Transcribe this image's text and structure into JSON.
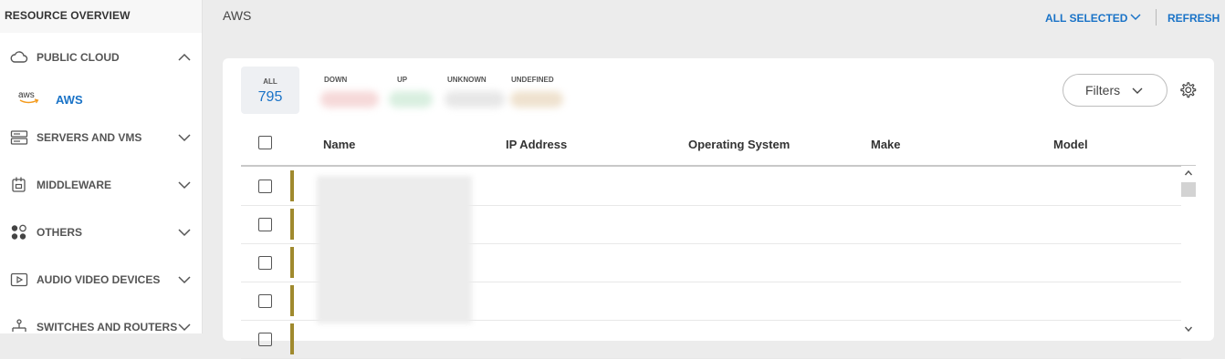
{
  "sidebar": {
    "title": "RESOURCE OVERVIEW",
    "items": [
      {
        "label": "PUBLIC CLOUD",
        "icon": "cloud-icon",
        "chevron": "chevron-up-icon"
      },
      {
        "label": "SERVERS AND VMS",
        "icon": "server-icon",
        "chevron": "chevron-down-icon"
      },
      {
        "label": "MIDDLEWARE",
        "icon": "middleware-icon",
        "chevron": "chevron-down-icon"
      },
      {
        "label": "OTHERS",
        "icon": "others-dots-icon",
        "chevron": "chevron-down-icon"
      },
      {
        "label": "AUDIO VIDEO DEVICES",
        "icon": "video-play-icon",
        "chevron": "chevron-down-icon"
      },
      {
        "label": "SWITCHES AND ROUTERS",
        "icon": "network-icon",
        "chevron": "chevron-down-icon"
      }
    ],
    "sub_item": {
      "label": "AWS",
      "icon": "aws-logo-icon",
      "logo_text": "aws"
    }
  },
  "header": {
    "title": "AWS",
    "all_selected": "ALL SELECTED",
    "refresh": "REFRESH"
  },
  "summary": {
    "all_label": "ALL",
    "all_count": "795",
    "stats": [
      {
        "label": "DOWN",
        "color": "#f6d9d9"
      },
      {
        "label": "UP",
        "color": "#d9efe0"
      },
      {
        "label": "UNKNOWN",
        "color": "#e7e7e7"
      },
      {
        "label": "UNDEFINED",
        "color": "#efe2cf"
      }
    ]
  },
  "toolbar": {
    "filters_label": "Filters"
  },
  "table": {
    "columns": [
      "Name",
      "IP Address",
      "Operating System",
      "Make",
      "Model"
    ],
    "row_status_color": "#a08a2e"
  },
  "colors": {
    "accent": "#1a73c7"
  }
}
